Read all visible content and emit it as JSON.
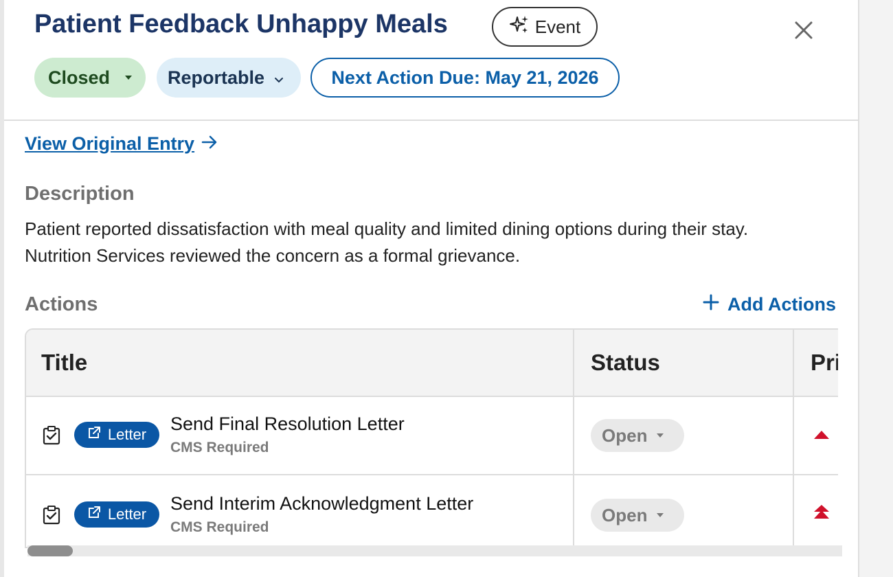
{
  "header": {
    "title": "Patient Feedback Unhappy Meals",
    "event_chip": "Event",
    "status_pill": "Closed",
    "reportable_pill": "Reportable",
    "next_action": "Next Action Due: May 21, 2026"
  },
  "view_original": "View Original Entry",
  "description": {
    "label": "Description",
    "line1": "Patient reported dissatisfaction with meal quality and limited dining options during their stay.",
    "line2": "Nutrition Services reviewed the concern as a formal grievance."
  },
  "actions": {
    "label": "Actions",
    "add_label": "Add Actions",
    "columns": [
      "Title",
      "Status",
      "Pri"
    ],
    "rows": [
      {
        "badge": "Letter",
        "title": "Send Final Resolution Letter",
        "subtitle": "CMS Required",
        "status": "Open",
        "priority": "high"
      },
      {
        "badge": "Letter",
        "title": "Send Interim Acknowledgment Letter",
        "subtitle": "CMS Required",
        "status": "Open",
        "priority": "urgent"
      }
    ]
  },
  "colors": {
    "brand_blue": "#0b5fa8",
    "closed_green": "#cdebd0",
    "priority_red": "#d0112b"
  },
  "icons": {
    "event": "sparkle-icon",
    "close": "close-icon",
    "arrow": "arrow-right-icon",
    "add": "plus-icon",
    "check": "clipboard-check-icon",
    "external": "external-link-icon"
  }
}
